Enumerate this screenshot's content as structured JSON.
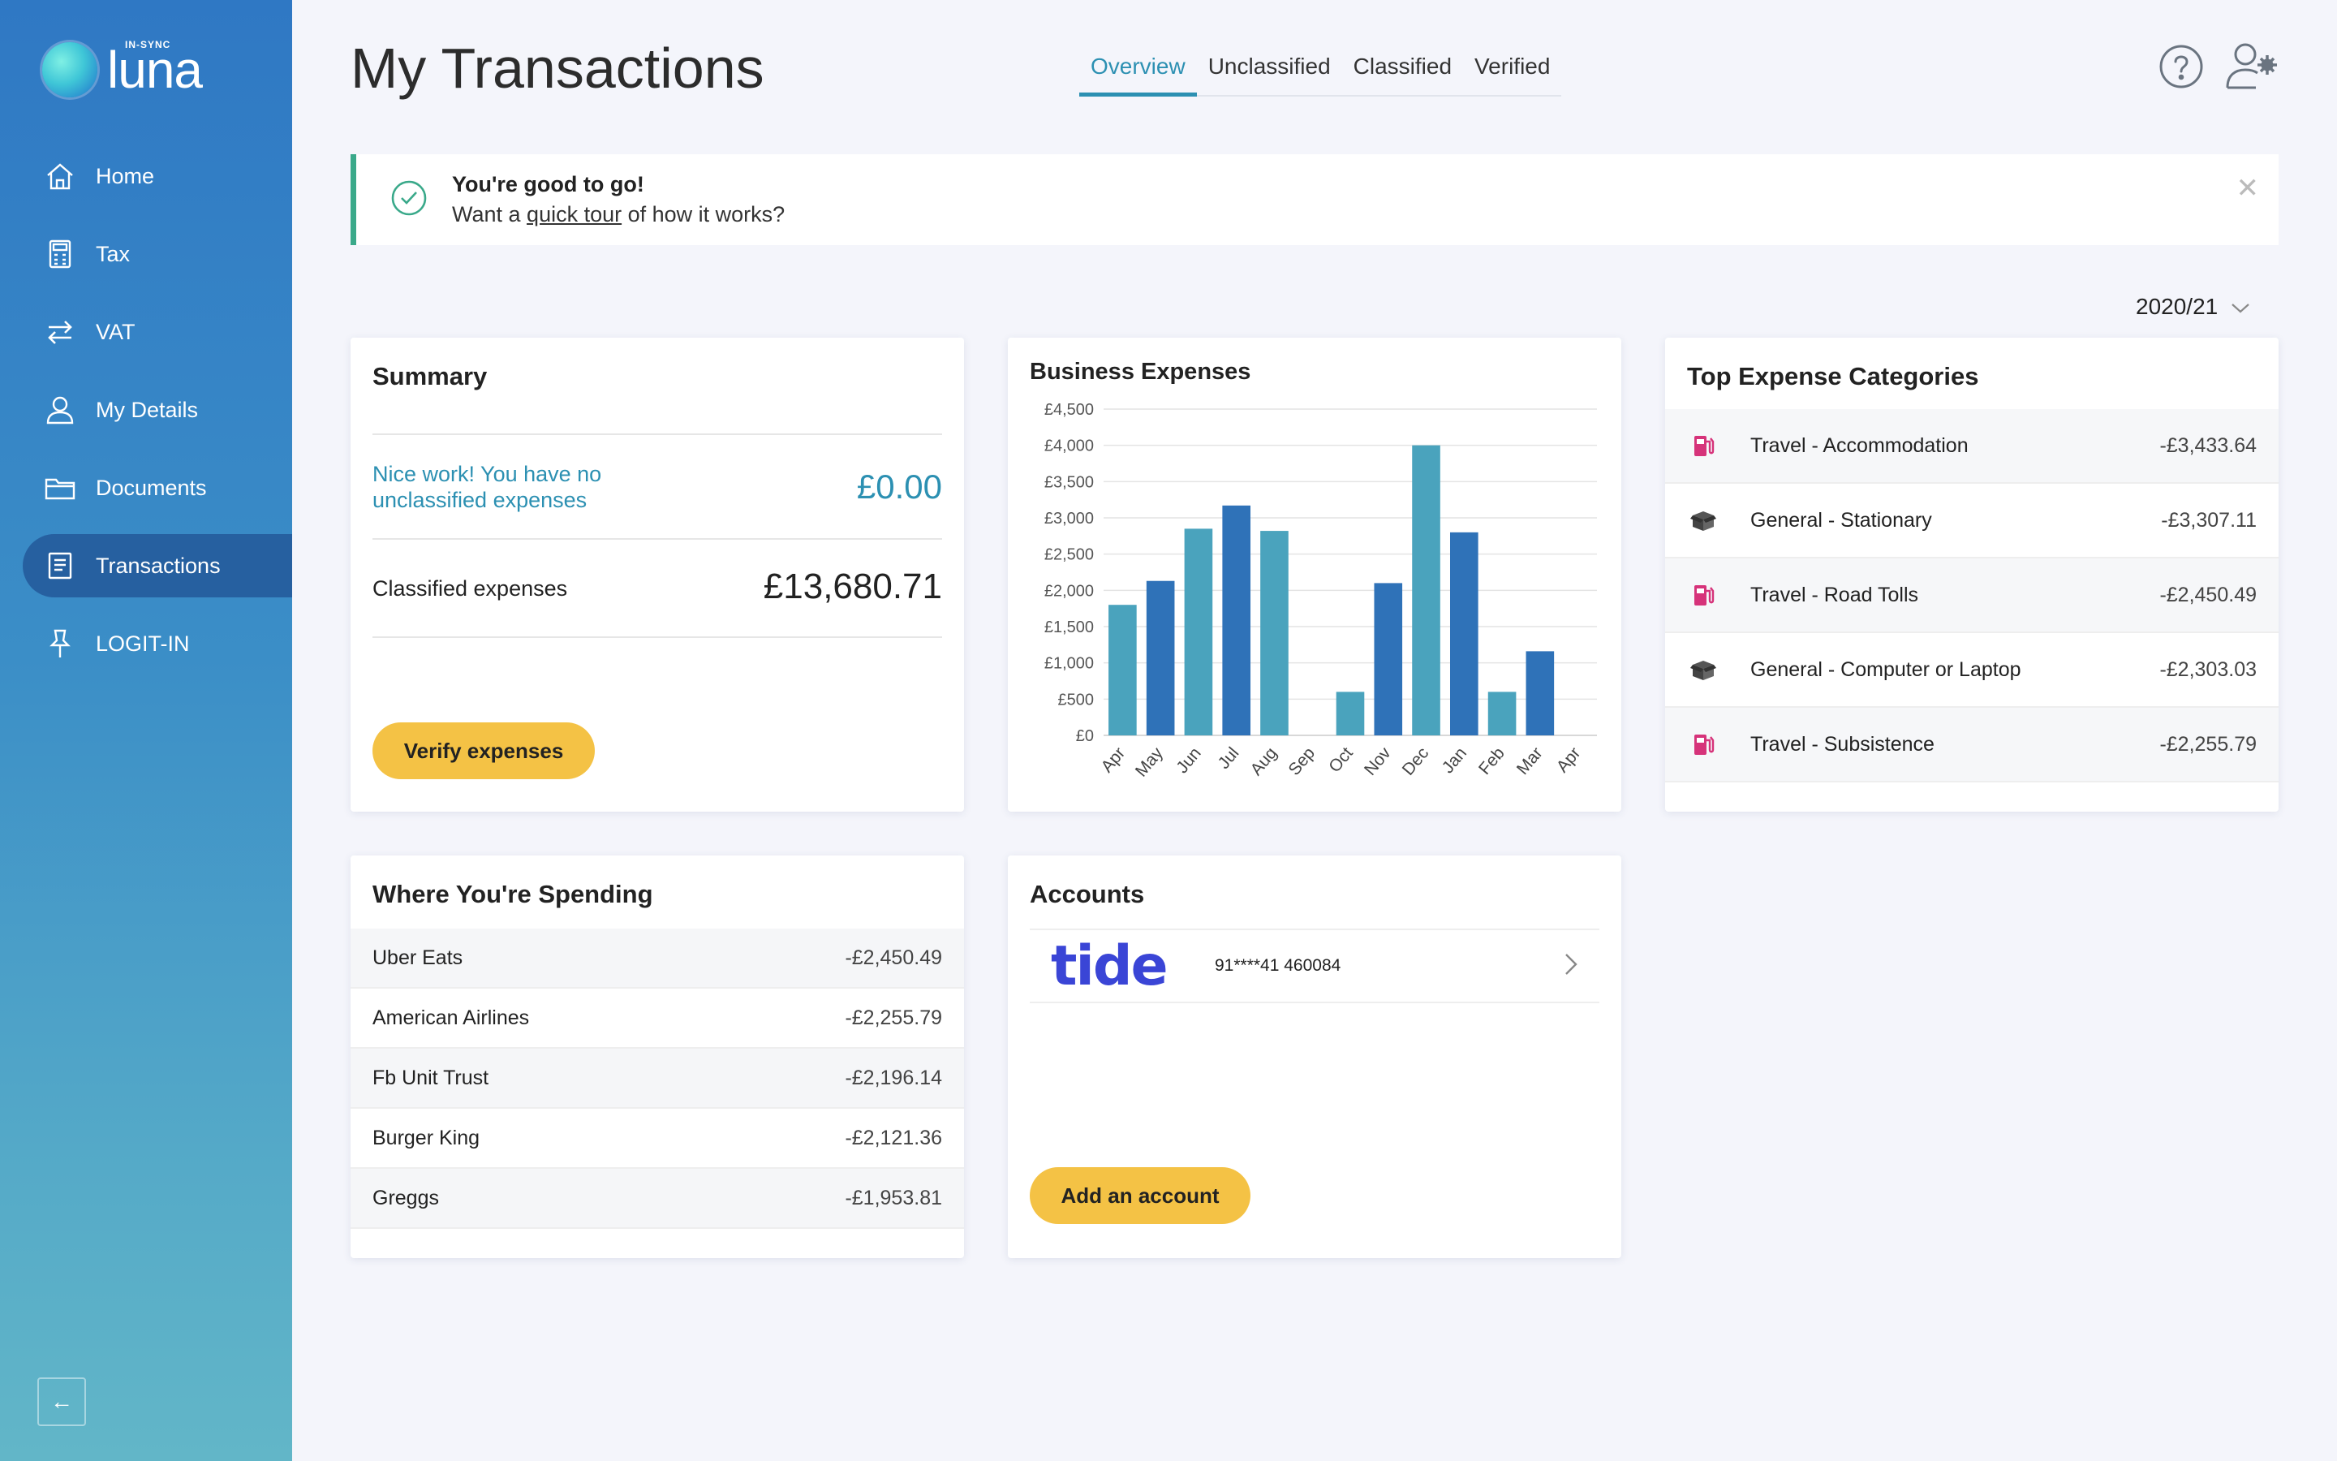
{
  "brand": {
    "name": "luna",
    "tagline": "IN-SYNC"
  },
  "sidebar": {
    "items": [
      {
        "label": "Home",
        "icon": "home-icon"
      },
      {
        "label": "Tax",
        "icon": "calculator-icon"
      },
      {
        "label": "VAT",
        "icon": "swap-arrows-icon"
      },
      {
        "label": "My Details",
        "icon": "person-icon"
      },
      {
        "label": "Documents",
        "icon": "folder-icon"
      },
      {
        "label": "Transactions",
        "icon": "receipt-icon",
        "active": true
      },
      {
        "label": "LOGIT-IN",
        "icon": "pin-icon"
      }
    ],
    "collapse_label": "←"
  },
  "header": {
    "title": "My Transactions",
    "tabs": [
      {
        "label": "Overview",
        "active": true
      },
      {
        "label": "Unclassified"
      },
      {
        "label": "Classified"
      },
      {
        "label": "Verified"
      }
    ]
  },
  "banner": {
    "title": "You're good to go!",
    "text_before": "Want a ",
    "link": "quick tour",
    "text_after": " of how it works?",
    "close": "✕"
  },
  "year_select": {
    "value": "2020/21"
  },
  "summary": {
    "title": "Summary",
    "note": "Nice work! You have no unclassified expenses",
    "unclassified_total": "£0.00",
    "classified_label": "Classified expenses",
    "classified_total": "£13,680.71",
    "verify_button": "Verify expenses"
  },
  "expenses_chart": {
    "title": "Business Expenses"
  },
  "chart_data": {
    "type": "bar",
    "title": "Business Expenses",
    "categories": [
      "Apr",
      "May",
      "Jun",
      "Jul",
      "Aug",
      "Sep",
      "Oct",
      "Nov",
      "Dec",
      "Jan",
      "Feb",
      "Mar",
      "Apr"
    ],
    "values": [
      1800,
      2130,
      2850,
      3170,
      2820,
      0,
      600,
      2100,
      4000,
      2800,
      600,
      1160,
      0
    ],
    "ylim": [
      0,
      4500
    ],
    "yticks": [
      "£0",
      "£500",
      "£1,000",
      "£1,500",
      "£2,000",
      "£2,500",
      "£3,000",
      "£3,500",
      "£4,000",
      "£4,500"
    ],
    "colors": [
      "#4aa3bd",
      "#2f72b8"
    ],
    "grid": true,
    "xlabel": "",
    "ylabel": ""
  },
  "top_categories": {
    "title": "Top Expense Categories",
    "items": [
      {
        "name": "Travel - Accommodation",
        "amount": "-£3,433.64",
        "icon": "fuel-pump-icon"
      },
      {
        "name": "General - Stationary",
        "amount": "-£3,307.11",
        "icon": "box-icon"
      },
      {
        "name": "Travel - Road Tolls",
        "amount": "-£2,450.49",
        "icon": "fuel-pump-icon"
      },
      {
        "name": "General - Computer or Laptop",
        "amount": "-£2,303.03",
        "icon": "box-icon"
      },
      {
        "name": "Travel - Subsistence",
        "amount": "-£2,255.79",
        "icon": "fuel-pump-icon"
      }
    ]
  },
  "spending": {
    "title": "Where You're Spending",
    "items": [
      {
        "name": "Uber Eats",
        "amount": "-£2,450.49"
      },
      {
        "name": "American Airlines",
        "amount": "-£2,255.79"
      },
      {
        "name": "Fb Unit Trust",
        "amount": "-£2,196.14"
      },
      {
        "name": "Burger King",
        "amount": "-£2,121.36"
      },
      {
        "name": "Greggs",
        "amount": "-£1,953.81"
      }
    ]
  },
  "accounts": {
    "title": "Accounts",
    "bank_logo": "tide",
    "account_number": "91****41 460084",
    "add_button": "Add an account"
  },
  "colors": {
    "accent": "#2c90b2",
    "button": "#f4c245",
    "banner_border": "#3aa98a",
    "travel_icon": "#d6337a",
    "tide_brand": "#3a45d6"
  }
}
